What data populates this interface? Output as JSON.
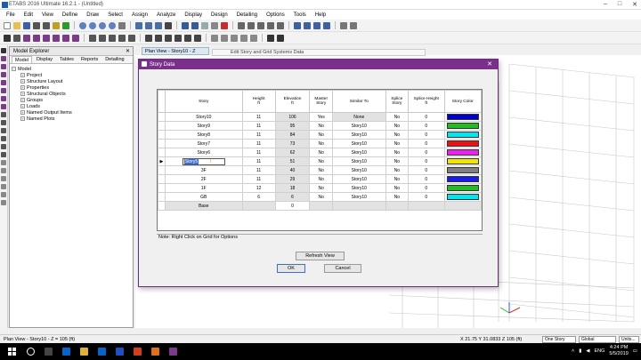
{
  "app": {
    "title": "ETABS 2016 Ultimate 16.2.1 - (Untitled)"
  },
  "menu": [
    "File",
    "Edit",
    "View",
    "Define",
    "Draw",
    "Select",
    "Assign",
    "Analyze",
    "Display",
    "Design",
    "Detailing",
    "Options",
    "Tools",
    "Help"
  ],
  "explorer": {
    "title": "Model Explorer",
    "tabs": [
      "Model",
      "Display",
      "Tables",
      "Reports",
      "Detailing"
    ],
    "root": "Model",
    "items": [
      "Project",
      "Structure Layout",
      "Properties",
      "Structural Objects",
      "Groups",
      "Loads",
      "Named Output Items",
      "Named Plots"
    ]
  },
  "tabs": {
    "plan_view": "Plan View - Story10 - Z",
    "edit_grid": "Edit Story and Grid Systems Data"
  },
  "dialog": {
    "title": "Story Data",
    "headers": [
      "Story",
      "Height\nft",
      "Elevation\nft",
      "Master\nStory",
      "Similar To",
      "Splice\nStory",
      "Splice Height\nft",
      "Story Color"
    ],
    "rows": [
      {
        "story": "Story10",
        "height": "11",
        "elevation": "106",
        "master": "Yes",
        "similar": "None",
        "splice": "No",
        "splice_height": "0",
        "color": "#0000cc"
      },
      {
        "story": "Story9",
        "height": "11",
        "elevation": "95",
        "master": "No",
        "similar": "Story10",
        "splice": "No",
        "splice_height": "0",
        "color": "#22bb22"
      },
      {
        "story": "Story8",
        "height": "11",
        "elevation": "84",
        "master": "No",
        "similar": "Story10",
        "splice": "No",
        "splice_height": "0",
        "color": "#00e5ee"
      },
      {
        "story": "Story7",
        "height": "11",
        "elevation": "73",
        "master": "No",
        "similar": "Story10",
        "splice": "No",
        "splice_height": "0",
        "color": "#ee1111"
      },
      {
        "story": "Story6",
        "height": "11",
        "elevation": "62",
        "master": "No",
        "similar": "Story10",
        "splice": "No",
        "splice_height": "0",
        "color": "#ee22ee"
      },
      {
        "story": "Story5",
        "height": "11",
        "elevation": "51",
        "master": "No",
        "similar": "Story10",
        "splice": "No",
        "splice_height": "0",
        "color": "#f2e600"
      },
      {
        "story": "3F",
        "height": "11",
        "elevation": "40",
        "master": "No",
        "similar": "Story10",
        "splice": "No",
        "splice_height": "0",
        "color": "#808080"
      },
      {
        "story": "2F",
        "height": "11",
        "elevation": "29",
        "master": "No",
        "similar": "Story10",
        "splice": "No",
        "splice_height": "0",
        "color": "#1a1aee"
      },
      {
        "story": "1F",
        "height": "12",
        "elevation": "18",
        "master": "No",
        "similar": "Story10",
        "splice": "No",
        "splice_height": "0",
        "color": "#22bb22"
      },
      {
        "story": "GB",
        "height": "6",
        "elevation": "6",
        "master": "No",
        "similar": "Story10",
        "splice": "No",
        "splice_height": "0",
        "color": "#00e5ee"
      }
    ],
    "base": {
      "story": "Base",
      "elevation": "0"
    },
    "editing_value": "Story5",
    "note": "Note:   Right Click on Grid for Options",
    "refresh_label": "Refresh View",
    "ok_label": "OK",
    "cancel_label": "Cancel"
  },
  "status": {
    "left": "Plan View - Story10 - Z = 105 (ft)",
    "coords": "X 21.75  Y 31.0833  Z 105 (ft)",
    "story_mode": "One Story",
    "coord_sys": "Global",
    "units": "Units..."
  },
  "taskbar": {
    "lang": "ENG",
    "time": "4:24 PM",
    "date": "5/5/2019"
  }
}
